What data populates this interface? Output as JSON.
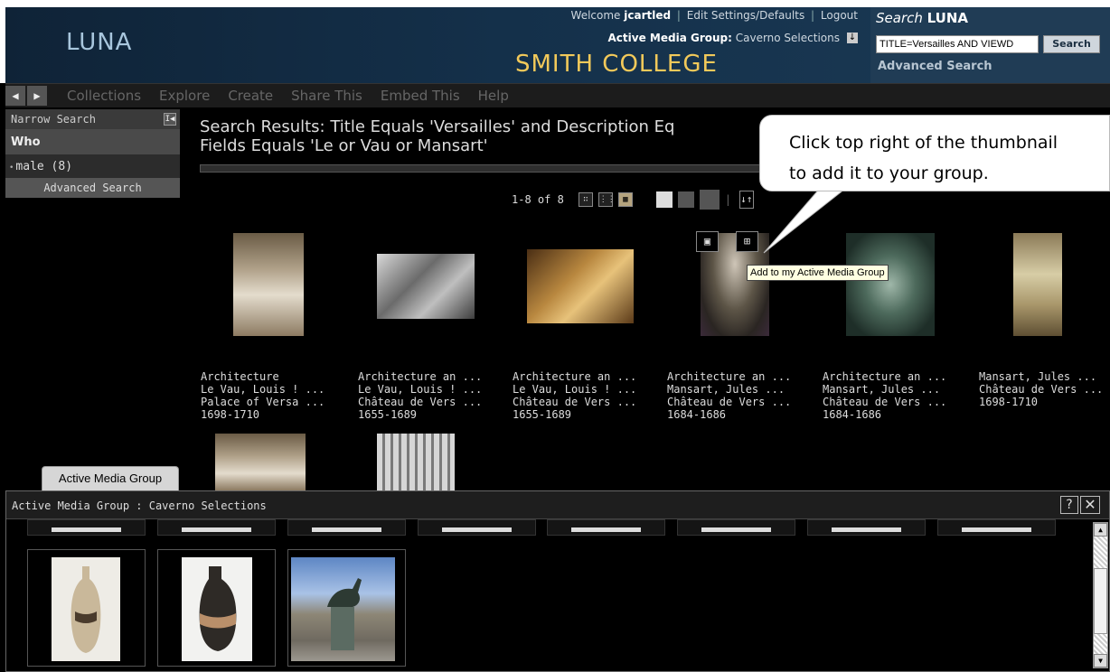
{
  "header": {
    "logo": "LUNA",
    "welcome_prefix": "Welcome",
    "username": "jcartled",
    "edit_settings": "Edit Settings/Defaults",
    "logout": "Logout",
    "amg_label": "Active Media Group:",
    "amg_value": "Caverno Selections",
    "college": "SMITH COLLEGE",
    "search_title_prefix": "Search",
    "search_title_brand": "LUNA",
    "search_value": "TITLE=Versailles AND VIEWD",
    "search_button": "Search",
    "advanced_search": "Advanced Search"
  },
  "nav": {
    "back_label": "◀",
    "forward_label": "▶",
    "items": [
      "Collections",
      "Explore",
      "Create",
      "Share This",
      "Embed This",
      "Help"
    ]
  },
  "sidebar": {
    "narrow_search": "Narrow Search",
    "toggle_label": "I◀",
    "who": "Who",
    "facet": "male (8)",
    "advanced_search": "Advanced Search"
  },
  "results": {
    "title_line1": "Search Results: Title Equals 'Versailles' and Description Eq",
    "title_line2": "Fields Equals 'Le or Vau or Mansart'",
    "count": "1-8 of 8",
    "view_small_label": "∷",
    "view_medium_label": "⋮⋮⋮",
    "view_large_label": "▦",
    "sort_label": "↓↑",
    "items": [
      {
        "lines": [
          "Architecture",
          "Le Vau, Louis ! ...",
          "Palace of Versa ...",
          "1698-1710"
        ]
      },
      {
        "lines": [
          "Architecture an ...",
          "Le Vau, Louis ! ...",
          "Château de Vers ...",
          "1655-1689"
        ]
      },
      {
        "lines": [
          "Architecture an ...",
          "Le Vau, Louis ! ...",
          "Château de Vers ...",
          "1655-1689"
        ]
      },
      {
        "lines": [
          "Architecture an ...",
          "Mansart, Jules ...",
          "Château de Vers ...",
          "1684-1686"
        ]
      },
      {
        "lines": [
          "Architecture an ...",
          "Mansart, Jules ...",
          "Château de Vers ...",
          "1684-1686"
        ]
      },
      {
        "lines": [
          "Mansart, Jules ...",
          "Château de Vers ...",
          "1698-1710"
        ]
      }
    ]
  },
  "callout": {
    "line1": "Click top right of the thumbnail",
    "line2": "to add it to your group."
  },
  "tooltip": "Add to my Active Media Group",
  "overlay": {
    "view_icon": "▣",
    "add_group_icon": "⊞"
  },
  "amg_panel": {
    "tab_label": "Active Media Group",
    "header": "Active Media Group : Caverno Selections",
    "help_label": "?",
    "close_label": "✕",
    "scroll_up": "▲",
    "scroll_down": "▼"
  },
  "colors": {
    "brand_gold": "#f2c95a",
    "banner_blue": "#14304a",
    "tooltip_bg": "#ffffe1"
  }
}
